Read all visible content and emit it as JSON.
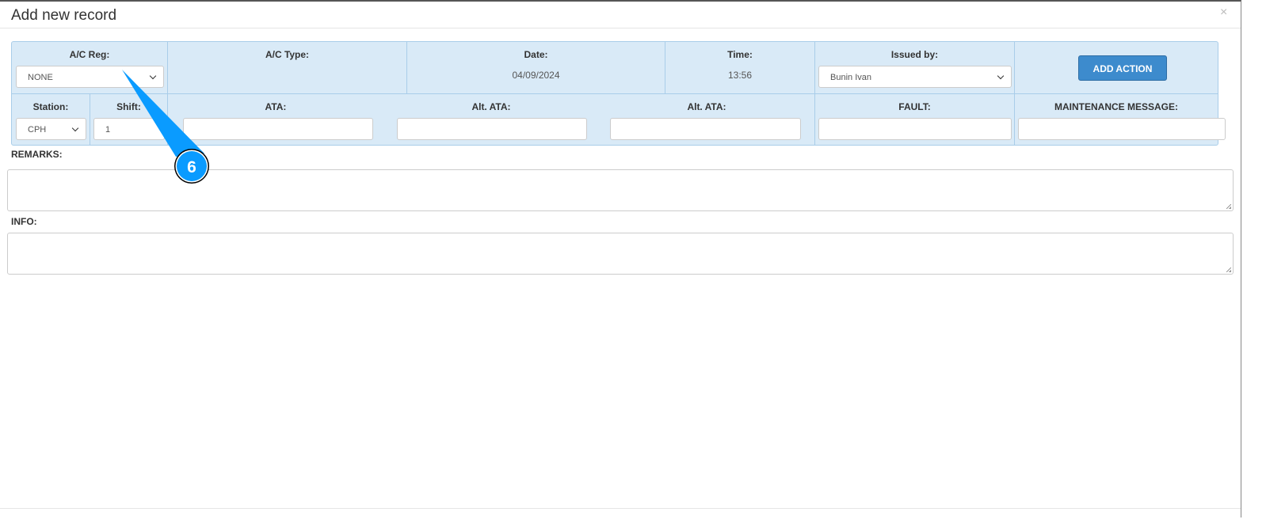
{
  "title": "Add new record",
  "close_icon": "×",
  "row1": {
    "ac_reg_label": "A/C Reg:",
    "ac_reg_value": "NONE",
    "ac_type_label": "A/C Type:",
    "date_label": "Date:",
    "date_value": "04/09/2024",
    "time_label": "Time:",
    "time_value": "13:56",
    "issued_label": "Issued by:",
    "issued_value": "Bunin Ivan",
    "add_action": "ADD ACTION"
  },
  "row2": {
    "station_label": "Station:",
    "station_value": "CPH",
    "shift_label": "Shift:",
    "shift_value": "1",
    "ata_label": "ATA:",
    "alt_ata1_label": "Alt. ATA:",
    "alt_ata2_label": "Alt. ATA:",
    "fault_label": "FAULT:",
    "mm_label": "MAINTENANCE MESSAGE:"
  },
  "remarks_label": "REMARKS:",
  "info_label": "INFO:",
  "callout": {
    "number": "6",
    "color": "#0a9bff"
  }
}
